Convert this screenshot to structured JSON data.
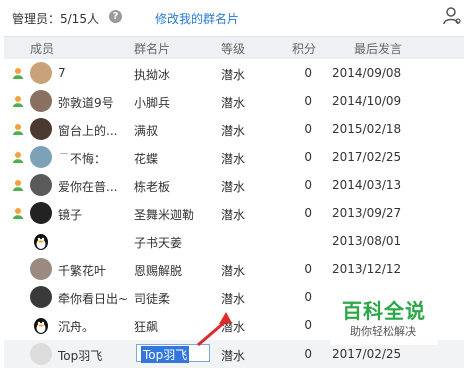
{
  "header": {
    "admin_label": "管理员：5/15人",
    "help_glyph": "?",
    "edit_link": "修改我的群名片"
  },
  "columns": {
    "member": "成员",
    "card": "群名片",
    "level": "等级",
    "points": "积分",
    "last_speak": "最后发言"
  },
  "rows": [
    {
      "admin": true,
      "avatar": "#c9a27a",
      "name": "7",
      "card": "执拗冰",
      "level": "潜水",
      "points": "0",
      "date": "2014/09/08"
    },
    {
      "admin": true,
      "avatar": "#8a7060",
      "name": "弥敦道9号",
      "card": "小脚兵",
      "level": "潜水",
      "points": "0",
      "date": "2014/10/09"
    },
    {
      "admin": true,
      "avatar": "#4a3a30",
      "name": "窗台上的...",
      "card": "满叔",
      "level": "潜水",
      "points": "0",
      "date": "2015/02/18"
    },
    {
      "admin": true,
      "avatar": "#7da2b8",
      "name": "﹉不悔：",
      "card": "花蝶",
      "level": "潜水",
      "points": "0",
      "date": "2017/02/25"
    },
    {
      "admin": true,
      "avatar": "#5a5a5a",
      "name": "爱你在普...",
      "card": "栋老板",
      "level": "潜水",
      "points": "0",
      "date": "2014/03/13"
    },
    {
      "admin": true,
      "avatar": "#222222",
      "name": "镜子",
      "card": "圣舞米迦勒",
      "level": "潜水",
      "points": "0",
      "date": "2013/09/27"
    },
    {
      "admin": false,
      "avatar": "qq",
      "name": "",
      "card": "子书天姜",
      "level": "",
      "points": "",
      "date": "2013/08/01"
    },
    {
      "admin": false,
      "avatar": "#9a8a80",
      "name": "千繁花叶",
      "card": "恩赐解脱",
      "level": "潜水",
      "points": "0",
      "date": "2013/12/12"
    },
    {
      "admin": false,
      "avatar": "#3a3a3a",
      "name": "牵你看日出~",
      "card": "司徒柔",
      "level": "潜水",
      "points": "0",
      "date": ""
    },
    {
      "admin": false,
      "avatar": "qq",
      "name": "沉舟。",
      "card": "狂飙",
      "level": "潜水",
      "points": "0",
      "date": ""
    }
  ],
  "editing_row": {
    "name": "Top羽飞",
    "card_value": "Top羽飞",
    "level": "潜水",
    "points": "0",
    "date": "2017/02/25"
  },
  "watermark": {
    "title": "百科全说",
    "subtitle": "助你轻松解决"
  },
  "colors": {
    "link": "#2a7ad3",
    "header_bg": "#eef0f3",
    "watermark_green": "#2aa847",
    "arrow_red": "#e02a2a"
  }
}
